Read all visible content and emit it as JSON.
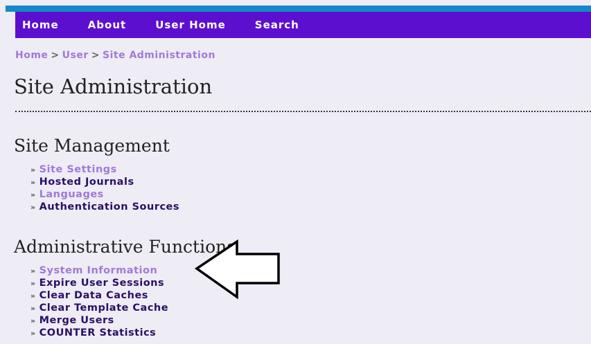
{
  "nav": {
    "items": [
      {
        "label": "Home"
      },
      {
        "label": "About"
      },
      {
        "label": "User Home"
      },
      {
        "label": "Search"
      }
    ]
  },
  "breadcrumb": {
    "items": [
      "Home",
      "User",
      "Site Administration"
    ],
    "separator": ">"
  },
  "page": {
    "title": "Site Administration"
  },
  "site_management": {
    "title": "Site Management",
    "items": [
      {
        "label": "Site Settings",
        "visited": true
      },
      {
        "label": "Hosted Journals",
        "visited": false
      },
      {
        "label": "Languages",
        "visited": true
      },
      {
        "label": "Authentication Sources",
        "visited": false
      }
    ]
  },
  "admin_functions": {
    "title": "Administrative Functions",
    "items": [
      {
        "label": "System Information",
        "visited": true
      },
      {
        "label": "Expire User Sessions",
        "visited": false
      },
      {
        "label": "Clear Data Caches",
        "visited": false
      },
      {
        "label": "Clear Template Cache",
        "visited": false
      },
      {
        "label": "Merge Users",
        "visited": false
      },
      {
        "label": "COUNTER Statistics",
        "visited": false
      }
    ]
  },
  "bullet": "»",
  "colors": {
    "top_stripe": "#1689c8",
    "navbar": "#5d0fd0",
    "link_visited": "#a07ad8",
    "link_unvisited": "#2a1066",
    "background": "#eeecf4"
  },
  "annotation": {
    "icon": "left-arrow-icon"
  }
}
